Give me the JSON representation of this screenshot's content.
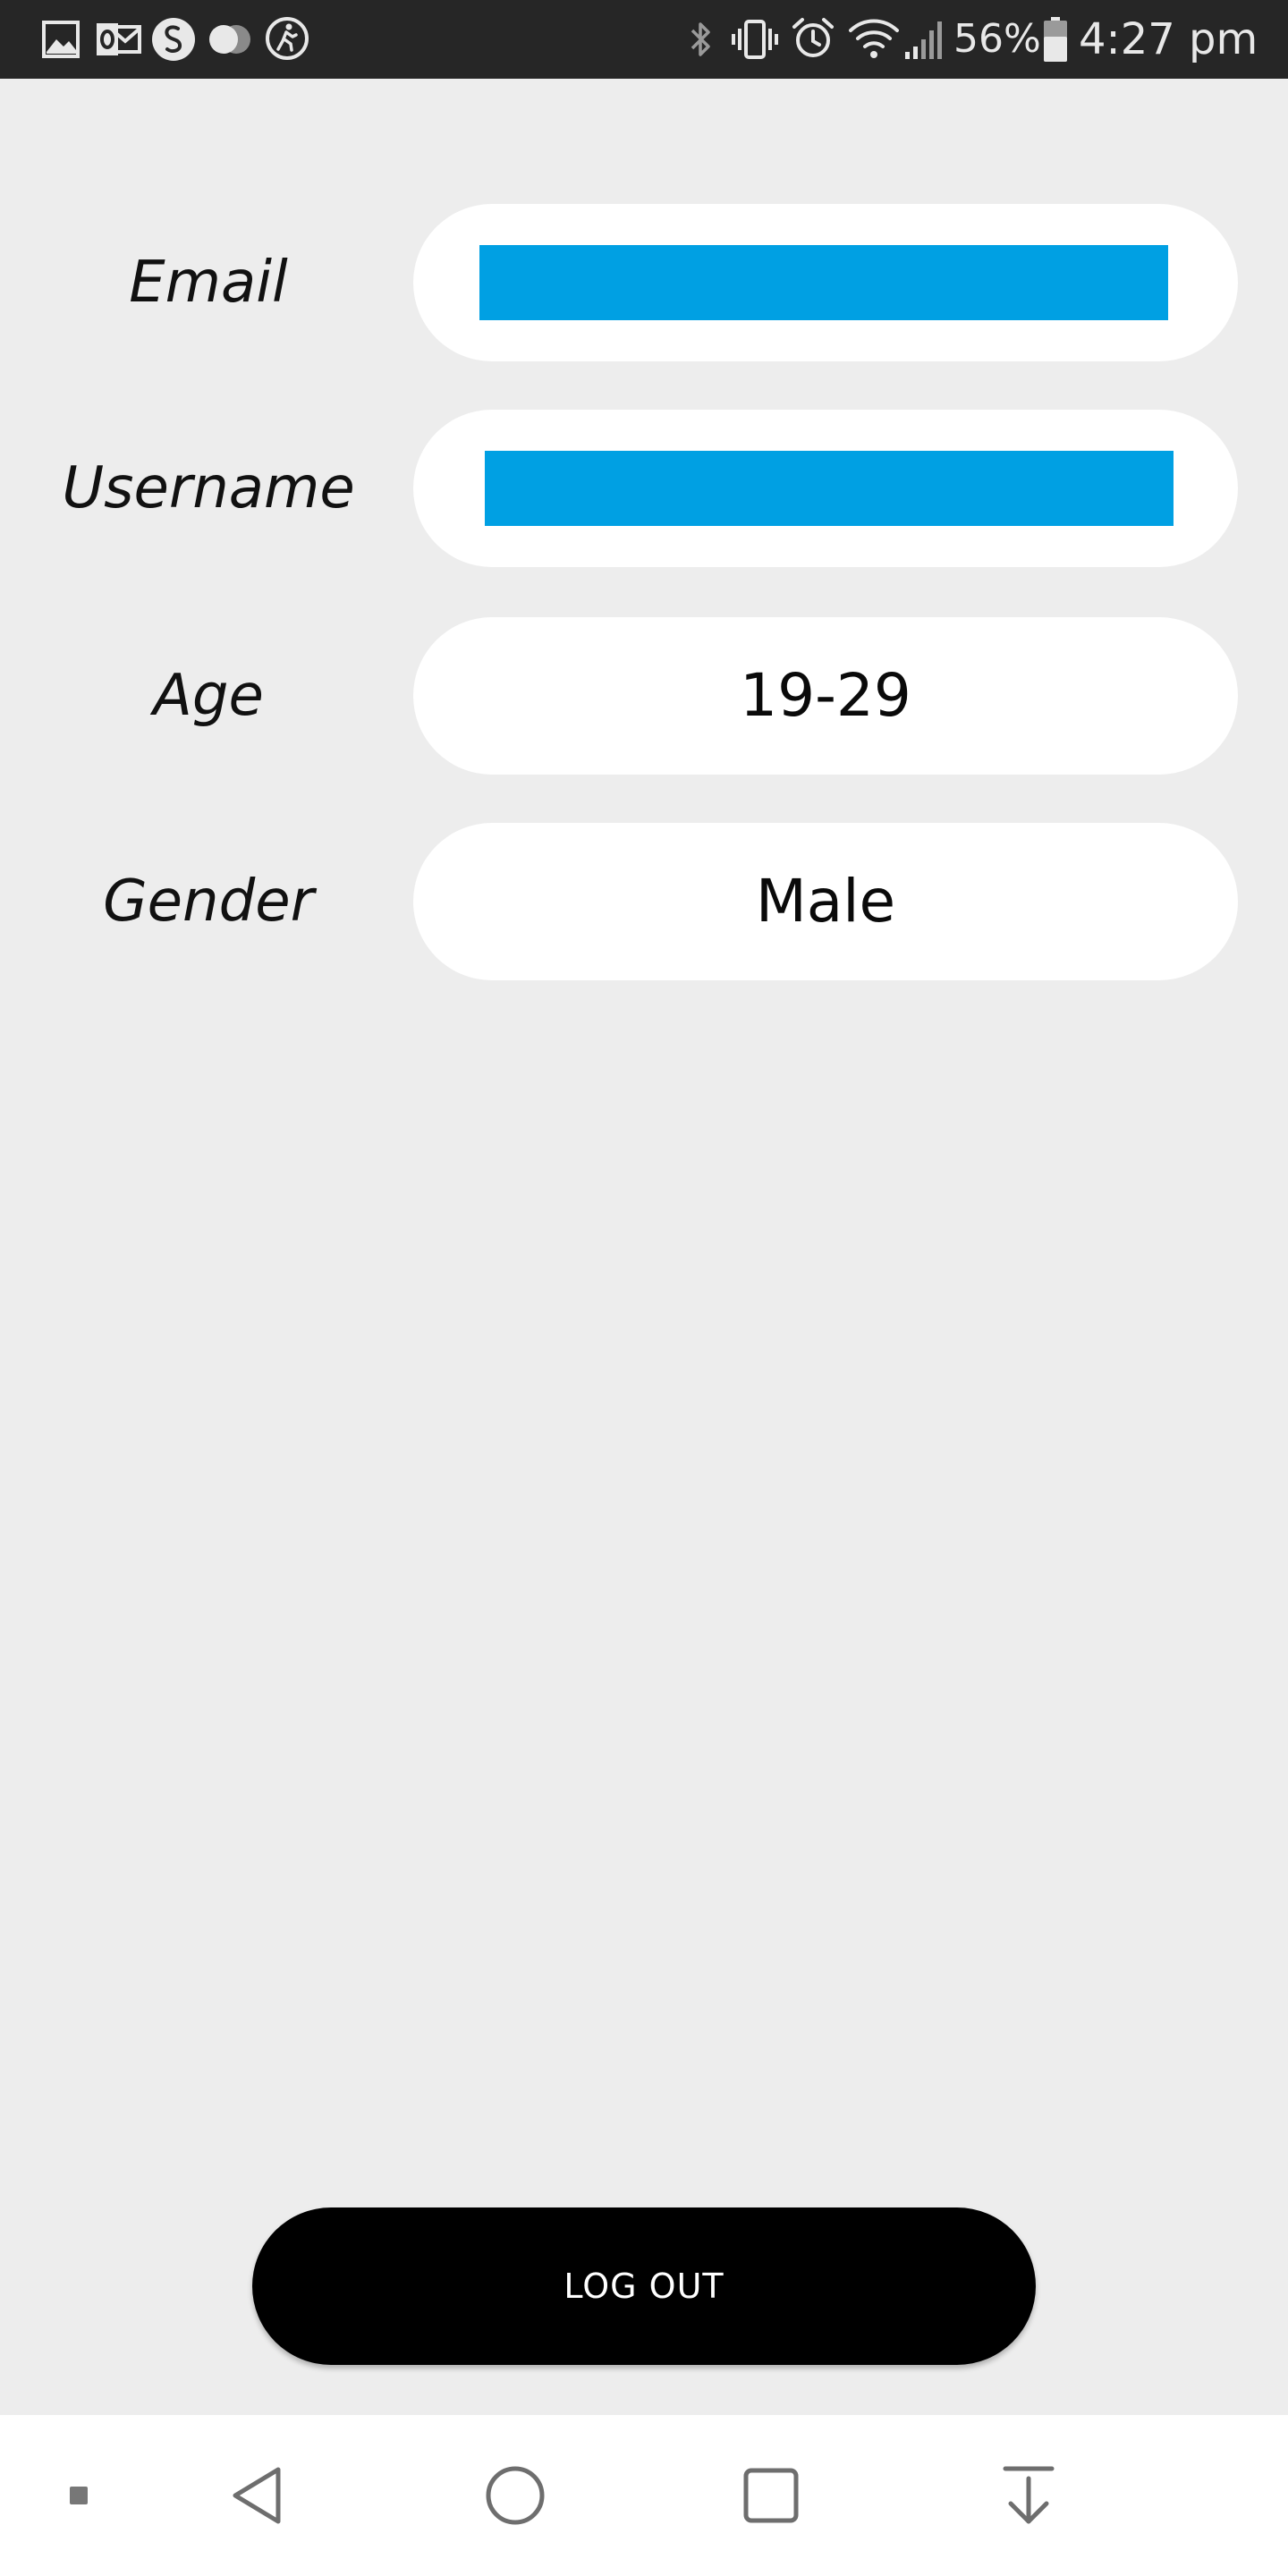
{
  "status_bar": {
    "battery_percent": "56%",
    "time": "4:27 pm",
    "left_icons": [
      "gallery-icon",
      "outlook-icon",
      "shazam-icon",
      "toggle-icon",
      "fitness-icon"
    ],
    "right_icons": [
      "bluetooth-icon",
      "vibrate-icon",
      "alarm-icon",
      "wifi-icon",
      "signal-icon",
      "battery-icon"
    ]
  },
  "profile": {
    "email": {
      "label": "Email",
      "value_redacted": true
    },
    "username": {
      "label": "Username",
      "value_redacted": true
    },
    "age": {
      "label": "Age",
      "value": "19-29"
    },
    "gender": {
      "label": "Gender",
      "value": "Male"
    }
  },
  "actions": {
    "logout_label": "LOG OUT"
  },
  "nav_bar": {
    "icons": [
      "dot-icon",
      "back-icon",
      "home-icon",
      "recents-icon",
      "download-icon"
    ]
  },
  "colors": {
    "background": "#ededed",
    "status_bar": "#262626",
    "pill": "#ffffff",
    "redaction": "#00a0e3",
    "button": "#000000",
    "button_text": "#ffffff"
  }
}
